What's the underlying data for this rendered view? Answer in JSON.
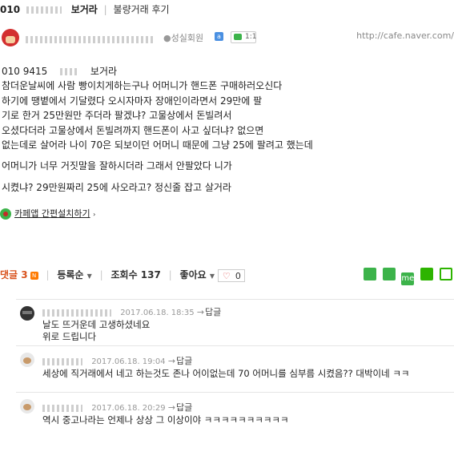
{
  "post": {
    "title_prefix": "010",
    "title_name": "보거라",
    "category": "불량거래 후기",
    "author_level": "성실회원",
    "chat_count": "1:1",
    "url": "http://cafe.naver.com/",
    "body_lines": [
      "010 9415",
      "참더운날씨에 사람 빵이치게하는구나 어머니가 핸드폰 구매하러오신다",
      "하기에 땡볕에서 기달렸다 오시자마자 장애인이라면서 29만에 팔",
      "기로 한거 25만원만 주더라 팔겠냐? 고물상에서 돈빌려서",
      "오셨다더라 고물상에서 돈빌려까지 핸드폰이 사고 싶더냐? 없으면",
      "없는데로 살어라 나이 70은 되보이던 어머니 때문에 그냥 25에 팔려고 했는데",
      "어머니가 너무 거짓말을 잘하시더라 그래서 안팔았다 니가",
      "시켰냐? 29만원짜리 25에 사오라고? 정신줄 잡고 살거라"
    ],
    "body_line1_tail": "보거라",
    "cafe_app_link": "카페앱 간편설치하기"
  },
  "comment_bar": {
    "label": "댓글 3",
    "new_badge": "N",
    "sort": "등록순",
    "views_label": "조회수 137",
    "likes_label": "좋아요",
    "like_count": "0",
    "share_me": "me"
  },
  "comments": [
    {
      "time": "2017.06.18. 18:35",
      "reply": "답글",
      "lines": [
        "날도 뜨거운데 고생하셨네요",
        "위로 드립니다"
      ]
    },
    {
      "time": "2017.06.18. 19:04",
      "reply": "답글",
      "lines": [
        "세상에 직거래에서 네고 하는것도 존나 어이없는데 70 어머니를 심부름 시켰음?? 대박이네 ㅋㅋ"
      ]
    },
    {
      "time": "2017.06.18. 20:29",
      "reply": "답글",
      "lines": [
        "역시 중고나라는 언제나 상상 그 이상이야 ㅋㅋㅋㅋㅋㅋㅋㅋㅋㅋ"
      ]
    }
  ],
  "colors": {
    "comment_accent": "#d9531e",
    "green": "#3cb34a",
    "badge_orange": "#ff7a00"
  }
}
